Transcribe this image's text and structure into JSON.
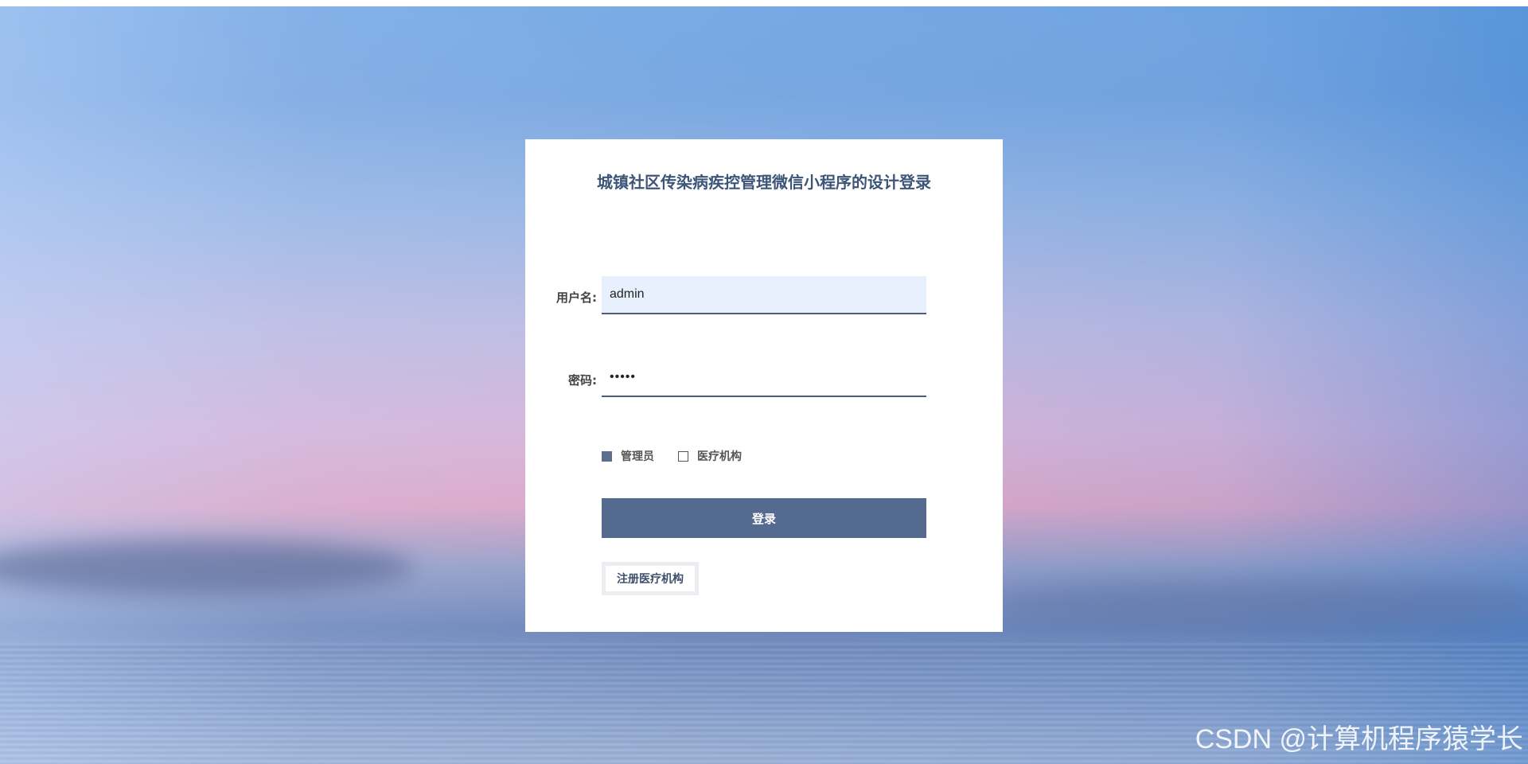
{
  "login": {
    "title": "城镇社区传染病疾控管理微信小程序的设计登录",
    "username_label": "用户名:",
    "username_value": "admin",
    "password_label": "密码:",
    "password_value": "•••••",
    "roles": [
      {
        "label": "管理员",
        "checked": true
      },
      {
        "label": "医疗机构",
        "checked": false
      }
    ],
    "login_button": "登录",
    "register_button": "注册医疗机构"
  },
  "watermark": "CSDN @计算机程序猿学长",
  "colors": {
    "title": "#3d5578",
    "button": "#556a8f",
    "input_autofill": "#e8f0fe",
    "checkbox_checked": "#5b6e8e"
  }
}
